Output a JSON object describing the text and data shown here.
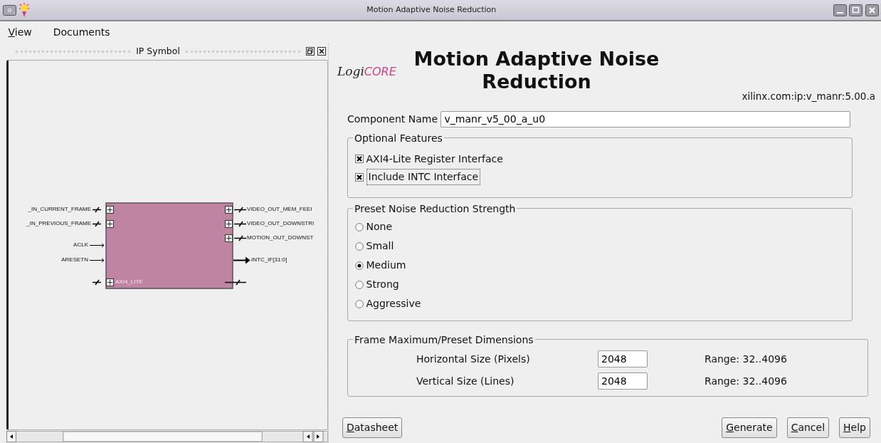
{
  "window": {
    "title": "Motion Adaptive Noise Reduction"
  },
  "menu": [
    {
      "label": "View",
      "mnemonic_underlined": true
    },
    {
      "label": "Documents",
      "mnemonic_underlined": false
    }
  ],
  "ip_symbol": {
    "title": "IP Symbol",
    "block_label": "AXI4_LITE",
    "left_ports": [
      {
        "label": "_IN_CURRENT_FRAME",
        "kind": "bus"
      },
      {
        "label": "_IN_PREVIOUS_FRAME",
        "kind": "bus"
      },
      {
        "label": "ACLK",
        "kind": "wire"
      },
      {
        "label": "ARESETN",
        "kind": "wire"
      }
    ],
    "right_ports": [
      {
        "label": "VIDEO_OUT_MEM_FEEI",
        "kind": "bus"
      },
      {
        "label": "VIDEO_OUT_DOWNSTRI",
        "kind": "bus"
      },
      {
        "label": "MOTION_OUT_DOWNST",
        "kind": "bus"
      },
      {
        "label": "INTC_IF[31:0]",
        "kind": "wire"
      }
    ]
  },
  "header": {
    "logo": [
      "Logi",
      "CORE"
    ],
    "title": "Motion Adaptive Noise Reduction",
    "vlnv": "xilinx.com:ip:v_manr:5.00.a"
  },
  "component_name": {
    "label": "Component Name",
    "value": "v_manr_v5_00_a_u0"
  },
  "optional_features": {
    "title": "Optional Features",
    "options": [
      {
        "label": "AXI4-Lite Register Interface",
        "checked": true,
        "focused": false
      },
      {
        "label": "Include INTC Interface",
        "checked": true,
        "focused": true
      }
    ]
  },
  "preset_strength": {
    "title": "Preset Noise Reduction Strength",
    "options": [
      {
        "label": "None",
        "selected": false
      },
      {
        "label": "Small",
        "selected": false
      },
      {
        "label": "Medium",
        "selected": true
      },
      {
        "label": "Strong",
        "selected": false
      },
      {
        "label": "Aggressive",
        "selected": false
      }
    ]
  },
  "frame_dimensions": {
    "title": "Frame Maximum/Preset Dimensions",
    "rows": [
      {
        "label": "Horizontal Size (Pixels)",
        "value": "2048",
        "range": "Range: 32..4096"
      },
      {
        "label": "Vertical Size (Lines)",
        "value": "2048",
        "range": "Range: 32..4096"
      }
    ]
  },
  "buttons_left": [
    {
      "label": "Datasheet",
      "mnemonic_underlined": true
    }
  ],
  "buttons_right": [
    {
      "label": "Generate",
      "mnemonic_underlined": true
    },
    {
      "label": "Cancel",
      "mnemonic_underlined": true
    },
    {
      "label": "Help",
      "mnemonic_underlined": true
    }
  ]
}
